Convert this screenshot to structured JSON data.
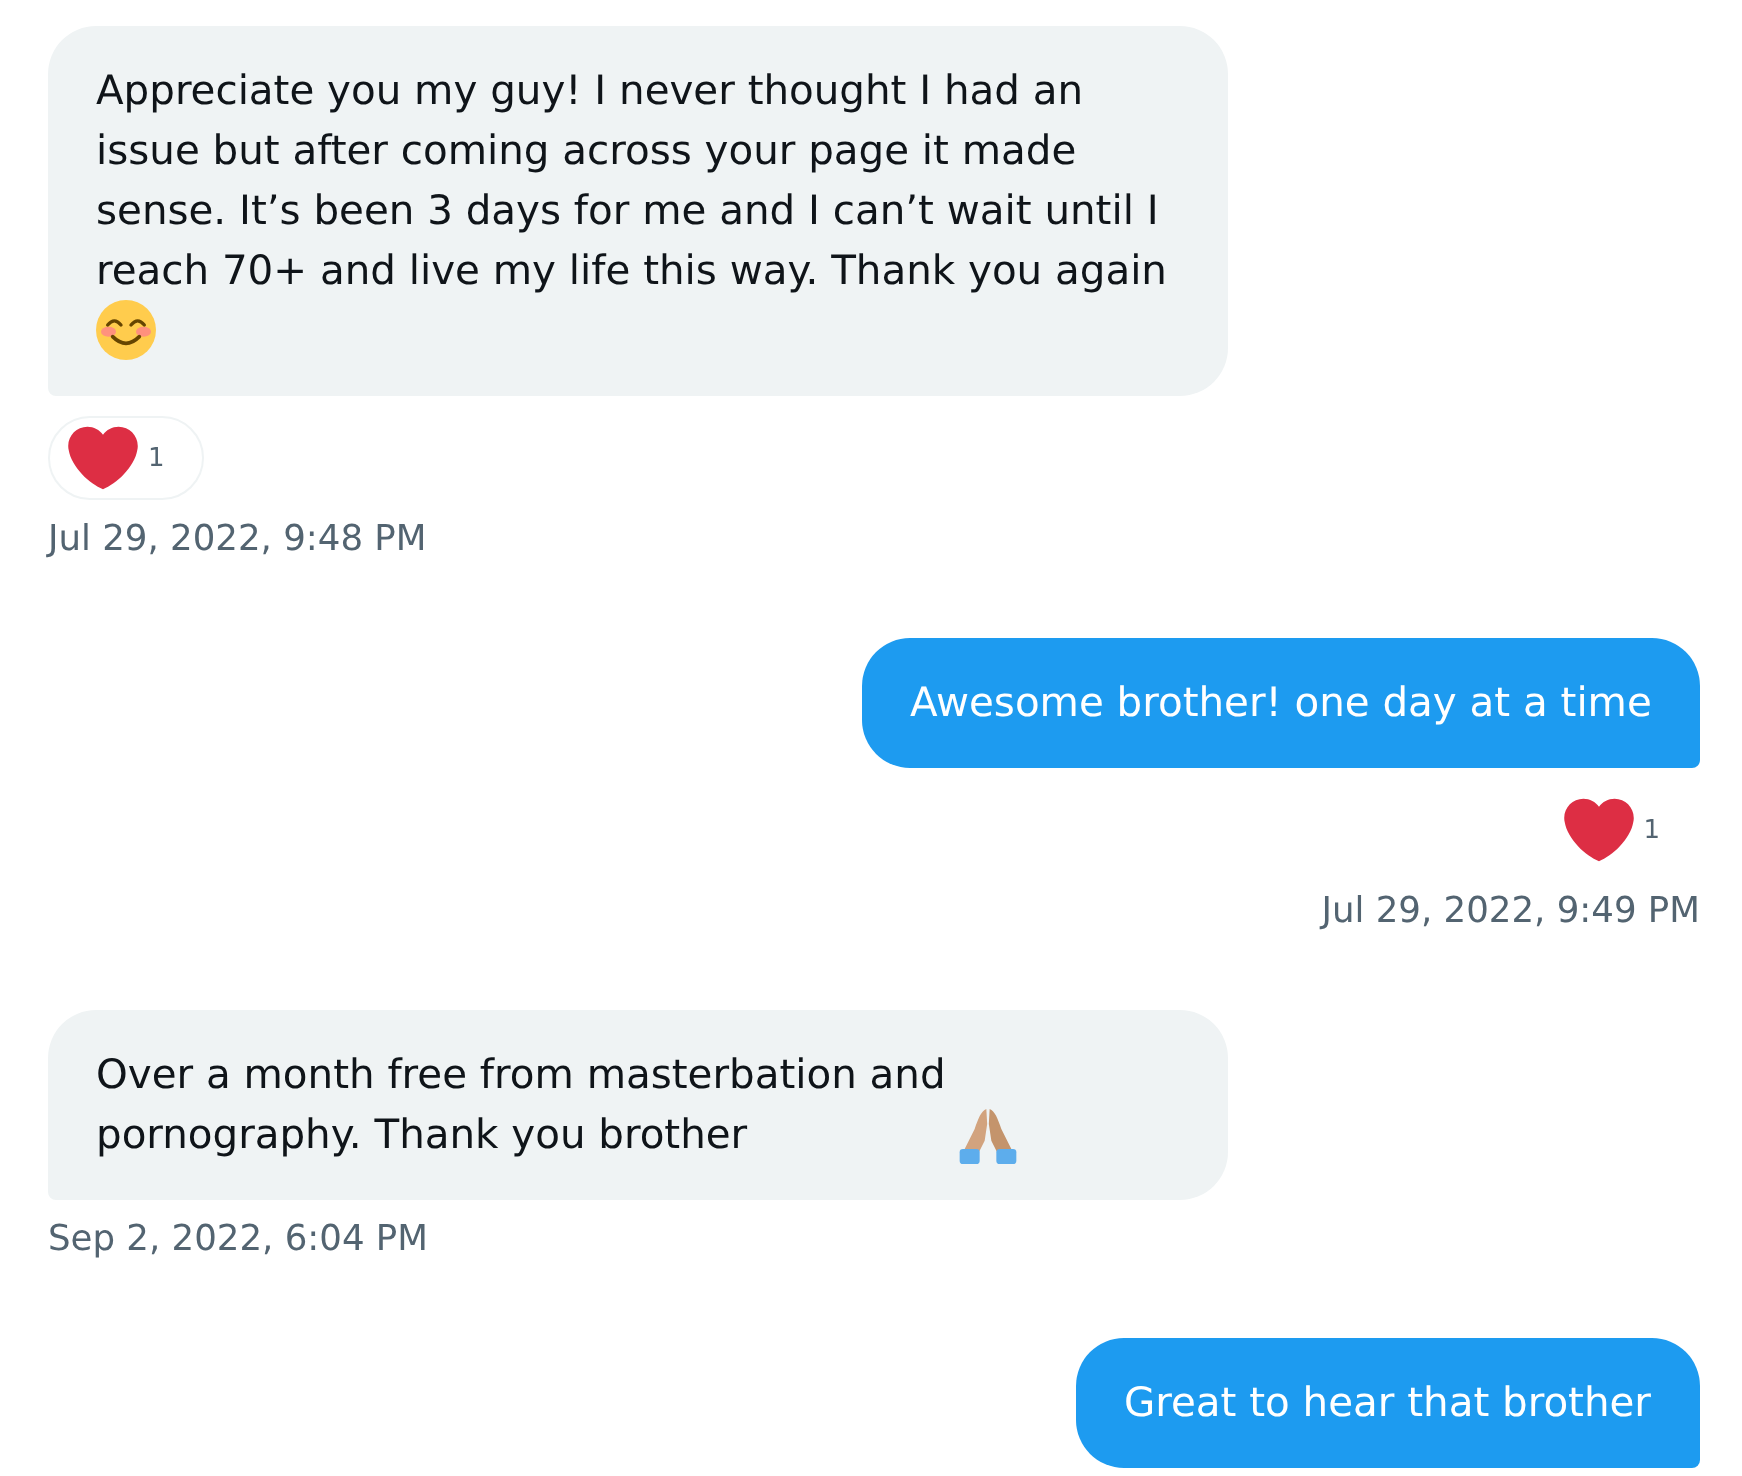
{
  "messages": [
    {
      "kind": "received",
      "text": "Appreciate you my guy! I never thought I had an issue but after coming across your page it made sense. It’s been 3 days for me and I can’t wait until I reach 70+ and live my life this way. Thank you again",
      "emoji": {
        "kind": "smile"
      },
      "reaction": {
        "count": "1"
      },
      "time": "Jul 29, 2022, 9:48 PM"
    },
    {
      "kind": "sent",
      "text": "Awesome brother! one day at a time",
      "reaction": {
        "count": "1"
      },
      "time": "Jul 29, 2022, 9:49 PM"
    },
    {
      "kind": "received",
      "text": "Over a month free from masterbation and pornography. Thank you brother",
      "emoji": {
        "kind": "pray"
      },
      "time": "Sep 2, 2022, 6:04 PM"
    },
    {
      "kind": "sent",
      "text": "Great to hear that brother"
    }
  ]
}
